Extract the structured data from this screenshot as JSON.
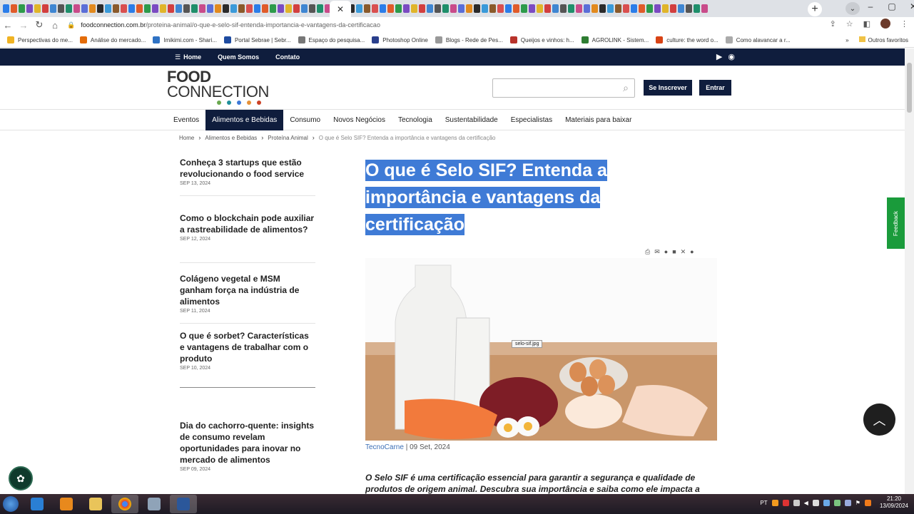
{
  "browser": {
    "tab_colors": [
      "#2b7de9",
      "#e05b2a",
      "#2d9b4b",
      "#7b4bc2",
      "#e0b52a",
      "#d23f3f",
      "#3f86d2",
      "#555555",
      "#1f8f6b",
      "#c94b8a",
      "#5a6ed8",
      "#e28a1e",
      "#2b2b2b",
      "#3a9ad9",
      "#8a5a2b",
      "#d94f4f"
    ],
    "active_tab_icon": "close-icon",
    "address": {
      "host": "foodconnection.com.br",
      "path": "/proteina-animal/o-que-e-selo-sif-entenda-importancia-e-vantagens-da-certificacao"
    },
    "bookmarks": [
      {
        "label": "Perspectivas do me...",
        "color": "#f0b323"
      },
      {
        "label": "Análise do mercado...",
        "color": "#e36c0a"
      },
      {
        "label": "Imikimi.com - Shari...",
        "color": "#2f72c4"
      },
      {
        "label": "Portal Sebrae | Sebr...",
        "color": "#1e4ba0"
      },
      {
        "label": "Espaço do pesquisa...",
        "color": "#777777"
      },
      {
        "label": "Photoshop Online",
        "color": "#2a3f8c"
      },
      {
        "label": "Blogs - Rede de Pes...",
        "color": "#999999"
      },
      {
        "label": "Queijos e vinhos: h...",
        "color": "#b8332b"
      },
      {
        "label": "AGROLINK - Sistem...",
        "color": "#2e7d32"
      },
      {
        "label": "culture: the word o...",
        "color": "#d84315"
      },
      {
        "label": "Como alavancar a r...",
        "color": "#aaaaaa"
      }
    ],
    "bookmarks_more": "»",
    "other_bookmarks": "Outros favoritos"
  },
  "site": {
    "topnav": [
      "Home",
      "Quem Somos",
      "Contato"
    ],
    "logo": {
      "line1": "FOOD",
      "line2": "CONNECTION",
      "dot_colors": [
        "#6aa84f",
        "#1f8f9b",
        "#3c78d8",
        "#e69138",
        "#cc4125"
      ]
    },
    "search_placeholder": "",
    "subscribe": "Se Inscrever",
    "login": "Entrar",
    "categories": [
      "Eventos",
      "Alimentos e Bebidas",
      "Consumo",
      "Novos Negócios",
      "Tecnologia",
      "Sustentabilidade",
      "Especialistas",
      "Materiais para baixar"
    ],
    "active_category": "Alimentos e Bebidas",
    "breadcrumb": [
      "Home",
      "Alimentos e Bebidas",
      "Proteína Animal",
      "O que é Selo SIF? Entenda a importância e vantagens da certificação"
    ],
    "sidebar": [
      {
        "title": "Conheça 3 startups que estão revolucionando o food service",
        "date": "SEP 13, 2024"
      },
      {
        "title": "Como o blockchain pode auxiliar a rastreabilidade de alimentos?",
        "date": "SEP 12, 2024"
      },
      {
        "title": "Colágeno vegetal e MSM ganham força na indústria de alimentos",
        "date": "SEP 11, 2024"
      },
      {
        "title": "O que é sorbet? Características e vantagens de trabalhar com o produto",
        "date": "SEP 10, 2024"
      },
      {
        "title": "Dia do cachorro-quente: insights de consumo revelam oportunidades para inovar no mercado de alimentos",
        "date": "SEP 09, 2024"
      }
    ],
    "article": {
      "title_lines": [
        "O que é Selo SIF? Entenda a",
        "importância e vantagens da",
        "certificação"
      ],
      "image_tooltip": "selo-sif.jpg",
      "source": "TecnoCarne",
      "date": "09 Set, 2024",
      "lead": "O Selo SIF é uma certificação essencial para garantir a segurança e qualidade de produtos de origem animal. Descubra sua importância e saiba como ele impacta a"
    },
    "feedback": "Feedback"
  },
  "taskbar": {
    "lang": "PT",
    "time": "21:20",
    "date": "13/09/2024"
  }
}
